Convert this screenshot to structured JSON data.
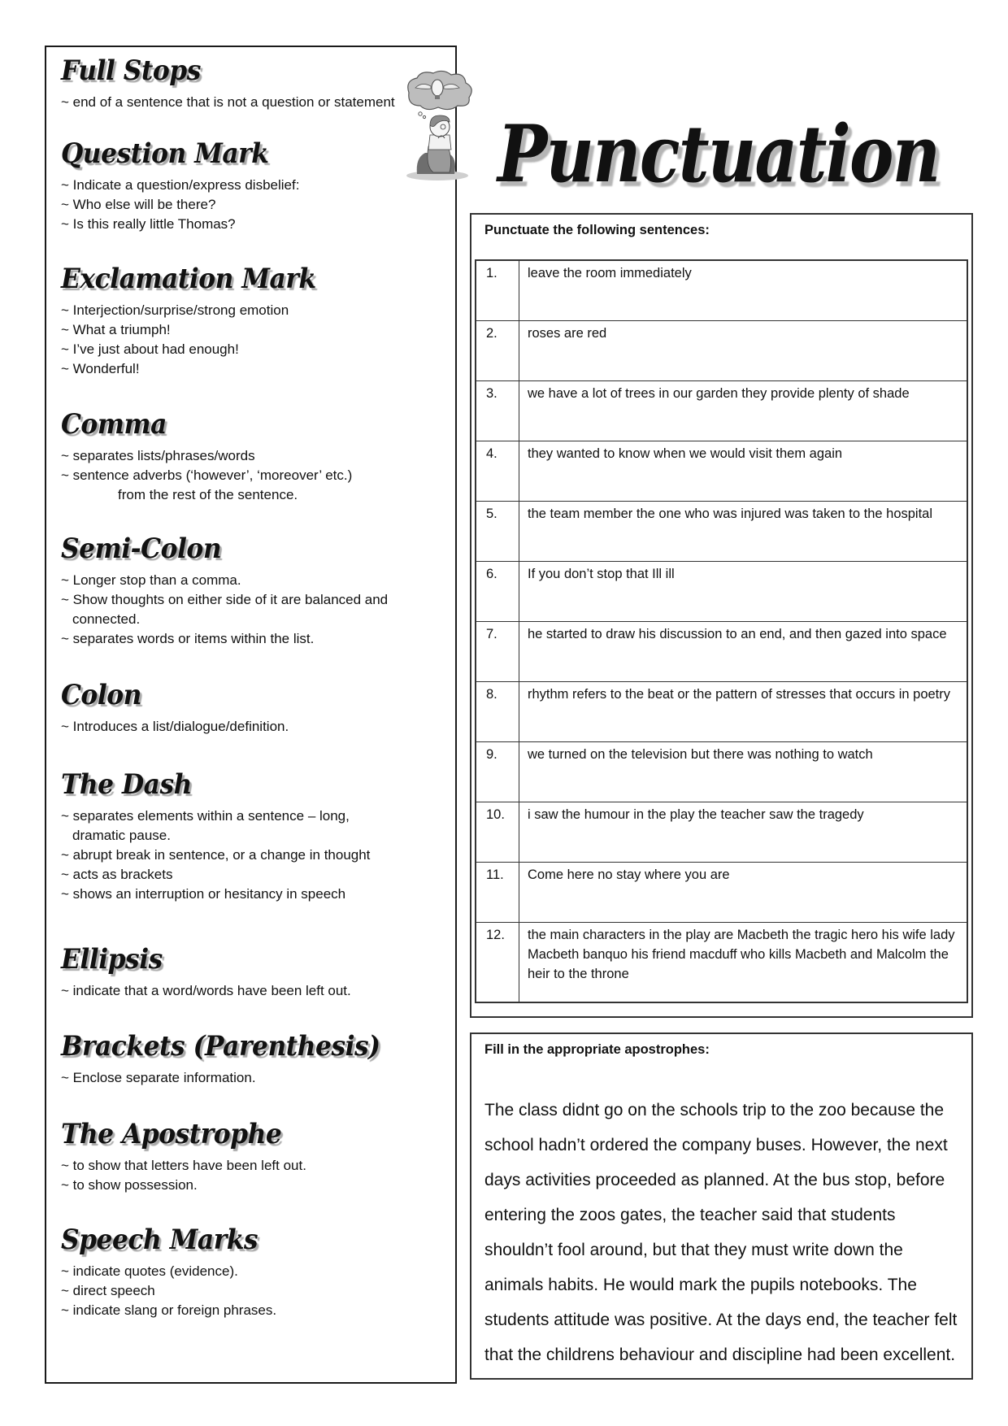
{
  "page": {
    "title": "Punctuation",
    "illustration": "girl-thinking-lightbulb-illustration"
  },
  "reference": {
    "sections": [
      {
        "heading": "Full Stops",
        "bullets": [
          "~ end of a sentence that is not a question or statement"
        ]
      },
      {
        "heading": "Question Mark",
        "bullets": [
          "~ Indicate a question/express disbelief:",
          "~ Who else will be there?",
          "~ Is this really little Thomas?"
        ]
      },
      {
        "heading": "Exclamation Mark",
        "bullets": [
          "~ Interjection/surprise/strong emotion",
          "~ What a triumph!",
          "~ I’ve just about had enough!",
          "~ Wonderful!"
        ]
      },
      {
        "heading": "Comma",
        "bullets": [
          "~ separates lists/phrases/words",
          "~ sentence adverbs (‘however’, ‘moreover’ etc.)",
          "from the rest of the sentence."
        ]
      },
      {
        "heading": "Semi-Colon",
        "bullets": [
          "~ Longer stop than a comma.",
          "~ Show thoughts on either side of it are balanced and",
          "connected.",
          "~ separates words or items within the list."
        ]
      },
      {
        "heading": "Colon",
        "bullets": [
          "~ Introduces a list/dialogue/definition."
        ]
      },
      {
        "heading": "The Dash",
        "bullets": [
          "~ separates elements within a sentence – long,",
          "dramatic pause.",
          "~ abrupt break in sentence, or a change in thought",
          "~ acts as brackets",
          "~ shows an interruption or hesitancy in speech"
        ]
      },
      {
        "heading": "Ellipsis",
        "bullets": [
          "~ indicate that a word/words have been left out."
        ]
      },
      {
        "heading": "Brackets (Parenthesis)",
        "bullets": [
          "~ Enclose separate information."
        ]
      },
      {
        "heading": "The Apostrophe",
        "bullets": [
          "~ to show that letters have been left out.",
          "~ to show possession."
        ]
      },
      {
        "heading": "Speech Marks",
        "bullets": [
          "~ indicate quotes (evidence).",
          "~ direct speech",
          "~ indicate slang or foreign phrases."
        ]
      }
    ]
  },
  "exercise1": {
    "title": "Punctuate the following sentences:",
    "items": [
      {
        "num": "1.",
        "text": "leave the room immediately"
      },
      {
        "num": "2.",
        "text": "roses are red"
      },
      {
        "num": "3.",
        "text": "we have a lot of trees in our garden  they provide plenty of shade"
      },
      {
        "num": "4.",
        "text": "they wanted to know when we would visit them again"
      },
      {
        "num": "5.",
        "text": "the team member the one who was injured was taken to the hospital"
      },
      {
        "num": "6.",
        "text": "If you don’t stop that Ill ill"
      },
      {
        "num": "7.",
        "text": "he started to draw his discussion to an end, and then gazed into space"
      },
      {
        "num": "8.",
        "text": "rhythm refers to the beat or the pattern of stresses that occurs in poetry"
      },
      {
        "num": "9.",
        "text": "we turned on the television but there was nothing to watch"
      },
      {
        "num": "10.",
        "text": "i saw the humour in the play the teacher saw the tragedy"
      },
      {
        "num": "11.",
        "text": "Come here no stay where you are"
      },
      {
        "num": "12.",
        "text": "the main characters in the play are Macbeth the tragic hero his wife lady Macbeth banquo his friend macduff who kills Macbeth and Malcolm the heir to the throne"
      }
    ]
  },
  "exercise2": {
    "title": "Fill in the appropriate apostrophes:",
    "passage": "The class didnt go on the schools trip to the zoo because the school hadn’t ordered the company buses.  However, the next days activities proceeded as planned.  At the bus stop, before entering the zoos gates, the teacher said that students shouldn’t fool around, but that they must write down the animals habits. He would mark the pupils notebooks.  The students attitude was positive.  At the days end, the teacher felt that the childrens behaviour and discipline had been excellent."
  }
}
